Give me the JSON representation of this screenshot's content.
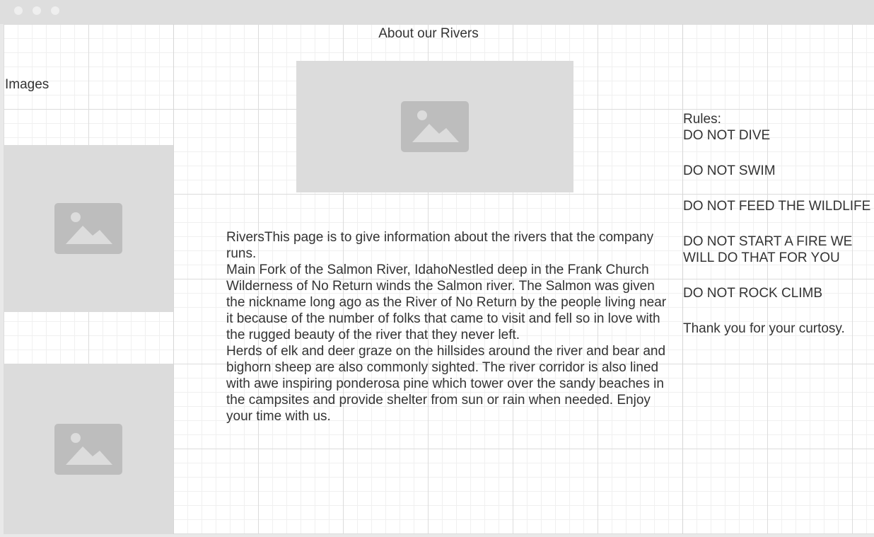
{
  "header": {
    "title": "About our Rivers"
  },
  "sidebar": {
    "label": "Images",
    "images": [
      {
        "icon": "image-placeholder-icon"
      },
      {
        "icon": "image-placeholder-icon"
      }
    ]
  },
  "main": {
    "hero_image": {
      "icon": "image-placeholder-icon"
    },
    "paragraphs": [
      "RiversThis page is to give information about the rivers that the company runs.",
      "Main Fork of the Salmon River, IdahoNestled deep in the Frank Church Wilderness of No Return winds the Salmon river. The Salmon was given the nickname long ago as the River of No Return by the people living near it because of the number of folks that came to visit and fell so in love with the rugged beauty of the river that they never left.",
      "Herds of elk and deer graze on the hillsides around the river and bear and bighorn sheep are also commonly sighted. The river corridor is also lined with awe inspiring ponderosa pine which tower over the sandy beaches in the campsites and provide shelter from sun or rain when needed. Enjoy your time with us."
    ]
  },
  "rules": {
    "title": "Rules:",
    "items": [
      "DO NOT DIVE",
      "DO NOT SWIM",
      "DO NOT FEED THE WILDLIFE",
      "DO NOT START A FIRE WE WILL DO THAT FOR YOU",
      "DO NOT ROCK CLIMB"
    ],
    "thanks": "Thank you for your curtosy."
  },
  "colors": {
    "titlebar": "#dedede",
    "placeholder": "#dcdcdc",
    "placeholder_icon": "#bdbdbd",
    "text": "#333333"
  }
}
